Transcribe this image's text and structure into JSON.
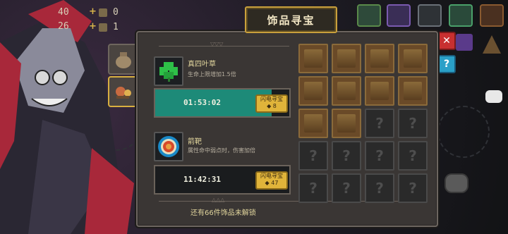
{
  "hud": {
    "count_a": "40",
    "count_b": "26",
    "stat_1": "0",
    "stat_2": "1",
    "plus_1": "+",
    "plus_2": "+"
  },
  "panel": {
    "title": "饰品寻宝",
    "footer": "还有66件饰品未解锁"
  },
  "items": [
    {
      "name": "真四叶草",
      "desc": "生命上限增加1.5倍",
      "timer": "01:53:02",
      "progress_fraction": 0.87,
      "button_label": "闪电寻宝",
      "button_cost": "8",
      "icon": "clover-icon"
    },
    {
      "name": "箭靶",
      "desc": "属性命中弱点时，伤害加倍",
      "timer": "11:42:31",
      "progress_fraction": 0.0,
      "button_label": "闪电寻宝",
      "button_cost": "47",
      "icon": "target-icon"
    }
  ],
  "colors": {
    "accent_gold": "#c9a03c",
    "progress_teal": "#1d8a78",
    "panel_bg": "#3a3634"
  }
}
